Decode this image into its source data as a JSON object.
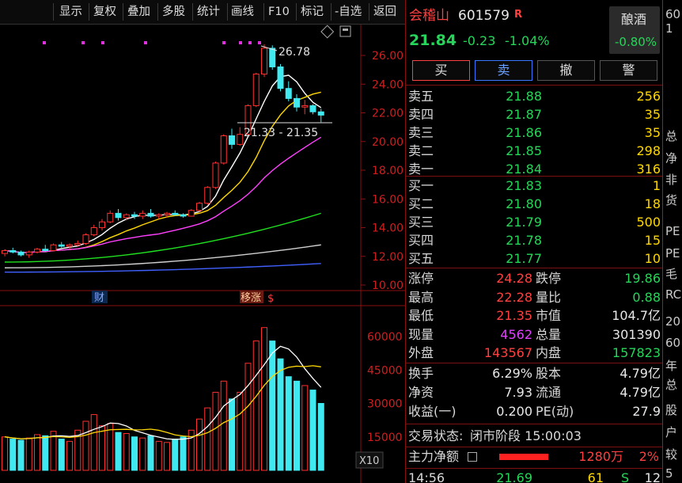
{
  "toolbar": {
    "items": [
      "显示",
      "复权",
      "叠加",
      "多股",
      "统计",
      "画线",
      "F10",
      "标记",
      "-自选",
      "返回"
    ]
  },
  "stock": {
    "name": "会稽山",
    "code": "601579",
    "flag": "R",
    "price": "21.84",
    "change": "-0.23",
    "change_pct": "-1.04%",
    "sector": "酿酒",
    "sector_change": "-0.80%"
  },
  "buttons": {
    "buy": "买",
    "sell": "卖",
    "cancel": "撤",
    "alert": "警"
  },
  "orderbook": {
    "asks": [
      {
        "label": "卖五",
        "price": "21.88",
        "vol": "256"
      },
      {
        "label": "卖四",
        "price": "21.87",
        "vol": "35"
      },
      {
        "label": "卖三",
        "price": "21.86",
        "vol": "35"
      },
      {
        "label": "卖二",
        "price": "21.85",
        "vol": "298"
      },
      {
        "label": "卖一",
        "price": "21.84",
        "vol": "316"
      }
    ],
    "bids": [
      {
        "label": "买一",
        "price": "21.83",
        "vol": "1"
      },
      {
        "label": "买二",
        "price": "21.80",
        "vol": "18"
      },
      {
        "label": "买三",
        "price": "21.79",
        "vol": "500"
      },
      {
        "label": "买四",
        "price": "21.78",
        "vol": "15"
      },
      {
        "label": "买五",
        "price": "21.77",
        "vol": "10"
      }
    ]
  },
  "stats": {
    "rows": [
      {
        "l1": "涨停",
        "v1": "24.28",
        "c1": "red",
        "l2": "跌停",
        "v2": "19.86",
        "c2": "grn"
      },
      {
        "l1": "最高",
        "v1": "22.28",
        "c1": "red",
        "l2": "量比",
        "v2": "0.88",
        "c2": "grn"
      },
      {
        "l1": "最低",
        "v1": "21.35",
        "c1": "red",
        "l2": "市值",
        "v2": "104.7亿",
        "c2": "wht"
      },
      {
        "l1": "现量",
        "v1": "4562",
        "c1": "mag",
        "l2": "总量",
        "v2": "301390",
        "c2": "wht"
      },
      {
        "l1": "外盘",
        "v1": "143567",
        "c1": "red",
        "l2": "内盘",
        "v2": "157823",
        "c2": "grn"
      }
    ]
  },
  "fund": {
    "rows": [
      {
        "l1": "换手",
        "v1": "6.29%",
        "l2": "股本",
        "v2": "4.79亿"
      },
      {
        "l1": "净资",
        "v1": "7.93",
        "l2": "流通",
        "v2": "4.79亿"
      },
      {
        "l1": "收益(一)",
        "v1": "0.200",
        "l2": "PE(动)",
        "v2": "27.9"
      }
    ]
  },
  "status": {
    "label": "交易状态:",
    "value": "闭市阶段 15:00:03"
  },
  "mainflow": {
    "label": "主力净额",
    "amount": "1280万",
    "pct": "2%"
  },
  "tick": {
    "time": "14:56",
    "price": "21.69",
    "vol": "61",
    "side": "S",
    "count": "12"
  },
  "far": {
    "labels": [
      "60",
      "1",
      "总",
      "净",
      "非",
      "货",
      "PE",
      "PE",
      "毛",
      "RC",
      "20",
      "60",
      "年",
      "总",
      "股",
      "户",
      "较",
      "5"
    ]
  },
  "chart_data": {
    "type": "candlestick",
    "price_axis": {
      "ticks": [
        "26.00",
        "24.00",
        "22.00",
        "20.00",
        "18.00",
        "16.00",
        "14.00",
        "12.00",
        "10.00"
      ],
      "min": 10,
      "max": 26
    },
    "volume_axis": {
      "ticks": [
        "60000",
        "45000",
        "30000",
        "15000"
      ],
      "multiplier": "X10"
    },
    "annotations": {
      "high_label": "26.78",
      "range_label": "21.33 - 21.35",
      "event_labels": [
        "财",
        "移涨",
        "$"
      ]
    },
    "candles": [
      [
        12.2,
        12.5,
        12.0,
        12.4
      ],
      [
        12.4,
        12.6,
        12.2,
        12.3
      ],
      [
        12.3,
        12.4,
        12.0,
        12.1
      ],
      [
        12.1,
        12.4,
        11.9,
        12.3
      ],
      [
        12.3,
        12.6,
        12.2,
        12.5
      ],
      [
        12.5,
        12.8,
        12.3,
        12.4
      ],
      [
        12.4,
        12.9,
        12.4,
        12.8
      ],
      [
        12.8,
        13.0,
        12.6,
        12.7
      ],
      [
        12.7,
        12.9,
        12.5,
        12.8
      ],
      [
        12.8,
        13.1,
        12.7,
        12.9
      ],
      [
        12.9,
        13.6,
        12.8,
        13.5
      ],
      [
        13.5,
        14.2,
        13.4,
        14.0
      ],
      [
        14.0,
        14.6,
        13.8,
        14.4
      ],
      [
        14.4,
        15.2,
        14.3,
        15.0
      ],
      [
        15.0,
        15.3,
        14.5,
        14.7
      ],
      [
        14.7,
        15.0,
        14.5,
        14.9
      ],
      [
        14.9,
        15.1,
        14.6,
        14.8
      ],
      [
        14.8,
        15.2,
        14.6,
        15.0
      ],
      [
        15.0,
        15.3,
        14.7,
        14.8
      ],
      [
        14.8,
        15.0,
        14.6,
        14.9
      ],
      [
        14.9,
        15.1,
        14.7,
        15.0
      ],
      [
        15.0,
        15.2,
        14.8,
        14.9
      ],
      [
        14.9,
        15.0,
        14.7,
        14.8
      ],
      [
        14.8,
        15.3,
        14.8,
        15.2
      ],
      [
        15.2,
        15.8,
        15.1,
        15.7
      ],
      [
        15.7,
        16.9,
        15.6,
        16.8
      ],
      [
        16.8,
        18.6,
        16.7,
        18.5
      ],
      [
        18.5,
        20.5,
        18.4,
        20.4
      ],
      [
        20.4,
        20.9,
        19.5,
        19.8
      ],
      [
        19.8,
        21.0,
        19.7,
        20.5
      ],
      [
        20.5,
        22.6,
        20.4,
        22.5
      ],
      [
        22.5,
        24.8,
        22.4,
        24.7
      ],
      [
        24.7,
        26.78,
        24.5,
        26.5
      ],
      [
        26.5,
        26.7,
        25.0,
        25.2
      ],
      [
        25.2,
        25.4,
        23.5,
        23.7
      ],
      [
        23.7,
        24.2,
        22.8,
        23.0
      ],
      [
        23.0,
        23.3,
        22.1,
        22.4
      ],
      [
        22.4,
        22.9,
        21.9,
        22.5
      ],
      [
        22.5,
        22.6,
        21.9,
        22.07
      ],
      [
        22.07,
        22.28,
        21.35,
        21.84
      ]
    ],
    "volumes": [
      15000,
      14000,
      13500,
      14500,
      16000,
      15500,
      17500,
      14000,
      13000,
      18000,
      22000,
      25000,
      20000,
      21000,
      17000,
      16500,
      15000,
      14500,
      15500,
      13000,
      12500,
      14000,
      15000,
      18000,
      23000,
      28000,
      35000,
      40000,
      32000,
      35000,
      48000,
      58000,
      64000,
      58000,
      50000,
      42000,
      40000,
      38000,
      36000,
      30000
    ],
    "ma_price": [
      {
        "name": "MA5",
        "color": "#ffffff"
      },
      {
        "name": "MA10",
        "color": "#ffd800"
      },
      {
        "name": "MA20",
        "color": "#ff40ff"
      },
      {
        "name": "MA30",
        "color": "#20e020"
      },
      {
        "name": "MA60",
        "color": "#d0d0d0"
      },
      {
        "name": "MA120",
        "color": "#4060ff"
      }
    ]
  }
}
